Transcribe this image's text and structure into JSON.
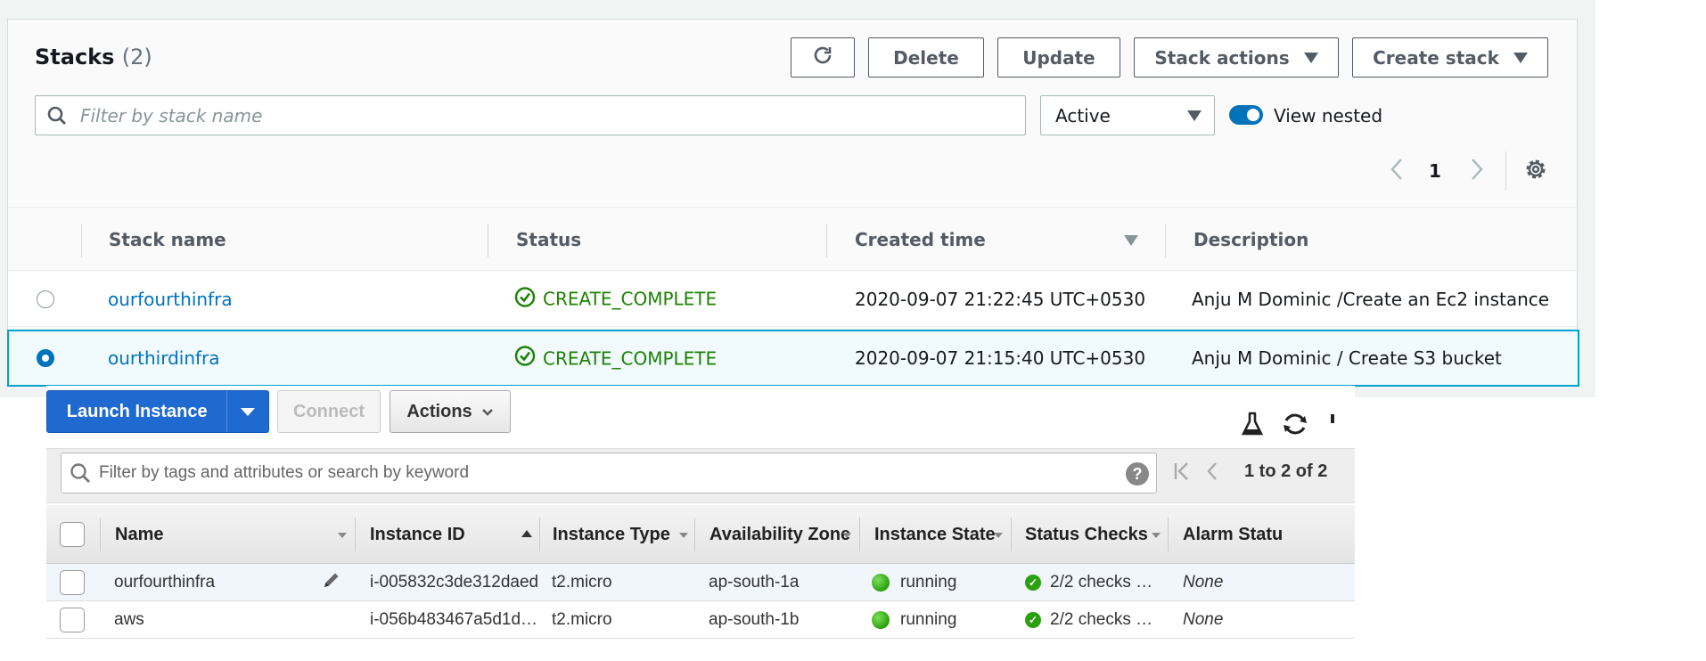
{
  "stacks": {
    "title": "Stacks",
    "count": "(2)",
    "buttons": {
      "delete": "Delete",
      "update": "Update",
      "stack_actions": "Stack actions",
      "create_stack": "Create stack"
    },
    "search_placeholder": "Filter by stack name",
    "filter_value": "Active",
    "view_nested_label": "View nested",
    "page_number": "1",
    "columns": [
      "Stack name",
      "Status",
      "Created time",
      "Description"
    ],
    "rows": [
      {
        "name": "ourfourthinfra",
        "status": "CREATE_COMPLETE",
        "created": "2020-09-07 21:22:45 UTC+0530",
        "description": "Anju M Dominic /Create an Ec2 instance",
        "selected": false
      },
      {
        "name": "ourthirdinfra",
        "status": "CREATE_COMPLETE",
        "created": "2020-09-07 21:15:40 UTC+0530",
        "description": "Anju M Dominic / Create S3 bucket",
        "selected": true
      }
    ]
  },
  "ec2": {
    "launch_label": "Launch Instance",
    "connect_label": "Connect",
    "actions_label": "Actions",
    "search_placeholder": "Filter by tags and attributes or search by keyword",
    "pager_text": "1 to 2 of 2",
    "columns": [
      "Name",
      "Instance ID",
      "Instance Type",
      "Availability Zone",
      "Instance State",
      "Status Checks",
      "Alarm Statu"
    ],
    "rows": [
      {
        "name": "ourfourthinfra",
        "id": "i-005832c3de312daed",
        "type": "t2.micro",
        "az": "ap-south-1a",
        "state": "running",
        "checks": "2/2 checks …",
        "alarm": "None"
      },
      {
        "name": "aws",
        "id": "i-056b483467a5d1d…",
        "type": "t2.micro",
        "az": "ap-south-1b",
        "state": "running",
        "checks": "2/2 checks …",
        "alarm": "None"
      }
    ]
  },
  "colors": {
    "link": "#0073bb",
    "status_success": "#1d8102",
    "primary_button": "#1f6ad1",
    "selected_row_border": "#00a1c9"
  }
}
